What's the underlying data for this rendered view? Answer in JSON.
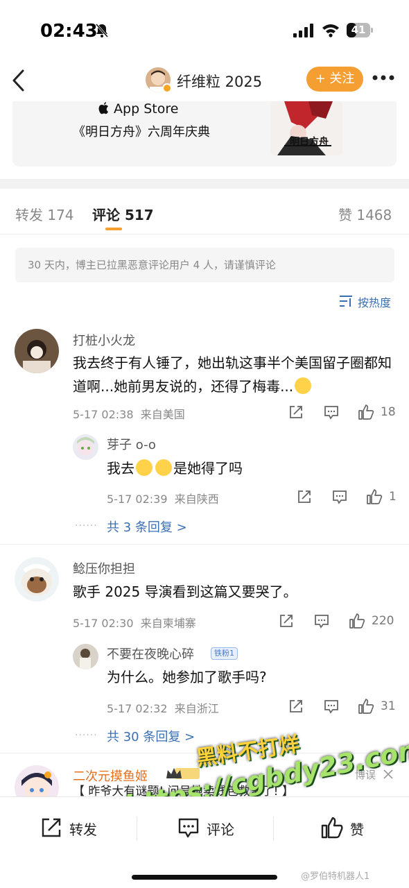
{
  "status": {
    "time": "02:43",
    "battery": "41",
    "battery_level": 0.41
  },
  "nav": {
    "title": "纤维粒 2025",
    "follow_label": "+ 关注"
  },
  "card": {
    "store": "App Store",
    "subtitle": "《明日方舟》六周年庆典",
    "image_text": "明日方舟"
  },
  "tabs": {
    "repost": "转发 174",
    "comment": "评论 517",
    "like": "赞 1468"
  },
  "notice": "30 天内，博主已拉黑恶意评论用户 4 人，请谨慎评论",
  "sort_label": "按热度",
  "comments": [
    {
      "user": "打桩小火龙",
      "text": "我去终于有人锤了，她出轨这事半个美国留子圈都知道啊...她前男友说的，还得了梅毒...",
      "time": "5-17 02:38",
      "location": "来自美国",
      "likes": "18",
      "reply": {
        "user": "芽子 o-o",
        "text_pre": "我去",
        "text_post": "是她得了吗",
        "time": "5-17 02:39",
        "location": "来自陕西",
        "likes": "1"
      },
      "more_replies": "共 3 条回复 >"
    },
    {
      "user": "鲶压你担担",
      "text": "歌手 2025 导演看到这篇又要哭了。",
      "time": "5-17 02:30",
      "location": "来自柬埔寨",
      "likes": "220",
      "reply": {
        "user": "不要在夜晚心碎",
        "badge": "铁粉1",
        "text": "为什么。她参加了歌手吗?",
        "time": "5-17 02:32",
        "location": "来自浙江",
        "likes": "31"
      },
      "more_replies": "共 30 条回复 >"
    },
    {
      "user": "二次元摸鱼姬",
      "text": "【 昨爷大有谜题! 问号她卖钱包救活了! 】",
      "extra": "博误"
    }
  ],
  "watermark": {
    "line1": "黑料不打烊",
    "line2": "https://cgbdy23.com"
  },
  "bottom": {
    "repost": "转发",
    "comment": "评论",
    "like": "赞"
  },
  "credit": "@罗伯特机器人1"
}
